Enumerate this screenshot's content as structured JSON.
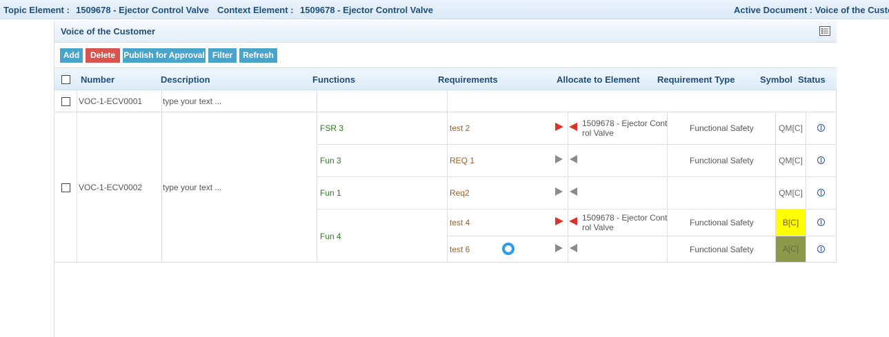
{
  "topbar": {
    "topic_label": "Topic Element :",
    "topic_value": "1509678 - Ejector Control Valve",
    "context_label": "Context Element :",
    "context_value": "1509678 - Ejector Control Valve",
    "active_doc": "Active Document : Voice of the Custom"
  },
  "panel": {
    "title": "Voice of the Customer",
    "icon": "grid-list-icon"
  },
  "toolbar": {
    "add": "Add",
    "delete": "Delete",
    "publish": "Publish for Approval",
    "filter": "Filter",
    "refresh": "Refresh",
    "colors": {
      "blue": "#4aa3c9",
      "red": "#d9534f"
    }
  },
  "columns": {
    "number": "Number",
    "description": "Description",
    "functions": "Functions",
    "requirements": "Requirements",
    "allocate": "Allocate to Element",
    "req_type": "Requirement Type",
    "symbol": "Symbol",
    "status": "Status"
  },
  "rows": [
    {
      "number": "VOC-1-ECV0001",
      "description": "type your text ..."
    },
    {
      "number": "VOC-1-ECV0002",
      "description": "type your text ...",
      "functions": [
        {
          "name": "FSR 3"
        },
        {
          "name": "Fun 3"
        },
        {
          "name": "Fun 1"
        },
        {
          "name": "Fun 4"
        }
      ],
      "requirements": [
        {
          "req": "test 2",
          "element": "1509678 - Ejector Control Valve",
          "type": "Functional Safety",
          "symbol": "QM[C]",
          "allocated": true
        },
        {
          "req": "REQ 1",
          "element": "",
          "type": "Functional Safety",
          "symbol": "QM[C]",
          "allocated": false
        },
        {
          "req": "Req2",
          "element": "",
          "type": "",
          "symbol": "QM[C]",
          "allocated": false
        },
        {
          "req": "test 4",
          "element": "1509678 - Ejector Control Valve",
          "type": "Functional Safety",
          "symbol": "B[C]",
          "allocated": true,
          "symbol_color": "#ffff00"
        },
        {
          "req": "test 6",
          "element": "",
          "type": "Functional Safety",
          "symbol": "A[C]",
          "allocated": false,
          "symbol_color": "#8b9a4a"
        }
      ]
    }
  ]
}
